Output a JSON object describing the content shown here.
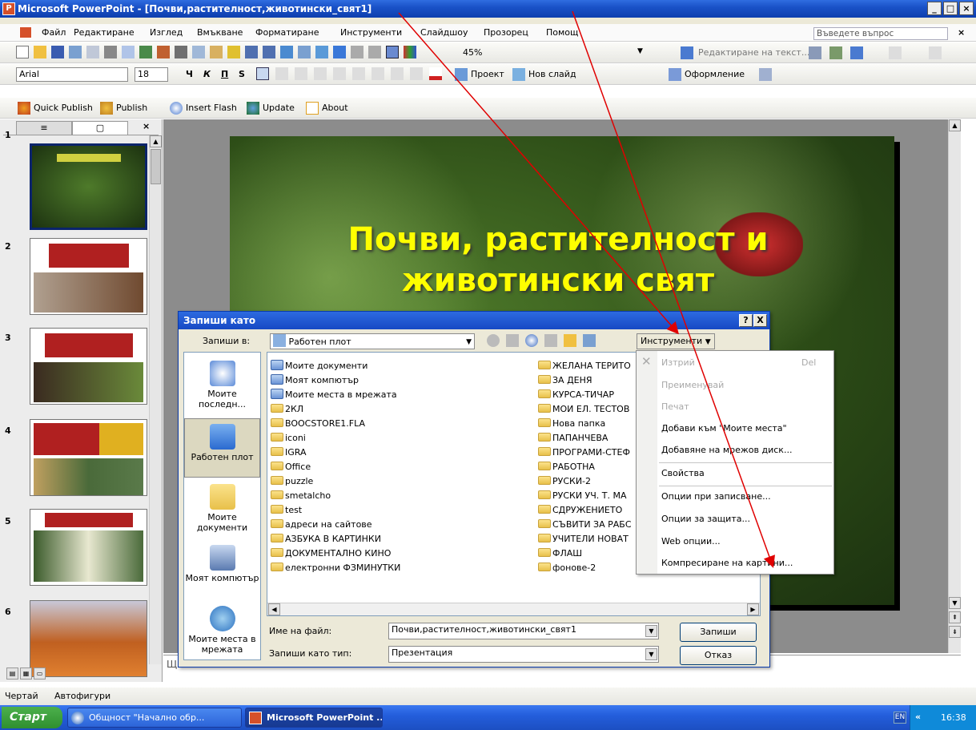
{
  "window": {
    "title": "Microsoft PowerPoint - [Почви,растителност,животински_свят1]",
    "app_icon": "P"
  },
  "menu": {
    "items": [
      "Файл",
      "Редактиране",
      "Изглед",
      "Вмъкване",
      "Форматиране",
      "Инструменти",
      "Слайдшоу",
      "Прозорец",
      "Помощ"
    ],
    "help_placeholder": "Въведете въпрос",
    "close": "× "
  },
  "standard_toolbar": {
    "zoom": "45%",
    "edit_text": "Редактиране на текст..."
  },
  "format_toolbar": {
    "font": "Arial",
    "size": "18",
    "bold": "Ч",
    "italic": "К",
    "underline": "П",
    "shadow": "S",
    "design_project": "Проект",
    "new_slide": "Нов слайд",
    "design": "Оформление"
  },
  "flash_toolbar": {
    "quick_publish": "Quick Publish",
    "publish": "Publish",
    "insert_flash": "Insert Flash",
    "update": "Update",
    "about": "About"
  },
  "thumbnails": {
    "numbers": [
      "1",
      "2",
      "3",
      "4",
      "5",
      "6"
    ]
  },
  "slide": {
    "title_line1": "Почви, растителност  и",
    "title_line2": "животински свят"
  },
  "notes": {
    "placeholder": "Щ"
  },
  "dialog": {
    "title": "Запиши като",
    "help": "?",
    "close": "X",
    "save_in_label": "Запиши в:",
    "save_in_value": "Работен плот",
    "tools_label": "Инструменти",
    "places": [
      "Моите последн...",
      "Работен плот",
      "Моите документи",
      "Моят компютър",
      "Моите места в мрежата"
    ],
    "files_col1": [
      "Моите документи",
      "Моят компютър",
      "Моите места в мрежата",
      "2КЛ",
      "BOOCSTORE1.FLA",
      "iconi",
      "IGRA",
      "Office",
      "puzzle",
      "smetalcho",
      "test",
      "адреси на сайтове",
      "АЗБУКА В КАРТИНКИ",
      "ДОКУМЕНТАЛНО КИНО",
      "електронни ФЗМИНУТКИ"
    ],
    "files_col2": [
      "ЖЕЛАНА ТЕРИТО",
      "ЗА ДЕНЯ",
      "КУРСА-ТИЧАР",
      "МОИ ЕЛ. ТЕСТОВ",
      "Нова папка",
      "ПАПАНЧЕВА",
      "ПРОГРАМИ-СТЕФ",
      "РАБОТНА",
      "РУСКИ-2",
      "РУСКИ УЧ. Т. МА",
      "СДРУЖЕНИЕТО",
      "СЪВИТИ ЗА РАБС",
      "УЧИТЕЛИ НОВАТ",
      "ФЛАШ",
      "фонове-2"
    ],
    "filename_label": "Име на файл:",
    "filename_value": "Почви,растителност,животински_свят1",
    "filetype_label": "Запиши като тип:",
    "filetype_value": "Презентация",
    "save_button": "Запиши",
    "cancel_button": "Отказ"
  },
  "tools_menu": {
    "delete": "Изтрий",
    "delete_shortcut": "Del",
    "rename": "Преименувай",
    "print": "Печат",
    "add_to_places": "Добави към \"Моите места\"",
    "map_drive": "Добавяне на мрежов диск...",
    "properties": "Свойства",
    "save_options": "Опции при записване...",
    "security_options": "Опции за защита...",
    "web_options": "Web опции...",
    "compress": "Компресиране на картини..."
  },
  "draw_toolbar": {
    "draw": "Чертай",
    "autoshapes": "Автофигури"
  },
  "taskbar": {
    "start": "Старт",
    "tasks": [
      "Общност \"Начално обр...",
      "Microsoft PowerPoint ..."
    ],
    "lang": "EN",
    "clock": "16:38",
    "chevron": "«"
  },
  "colors": {
    "title_blue": "#1a52c8",
    "slide_text": "#ffff00",
    "arrow": "#e00000"
  }
}
